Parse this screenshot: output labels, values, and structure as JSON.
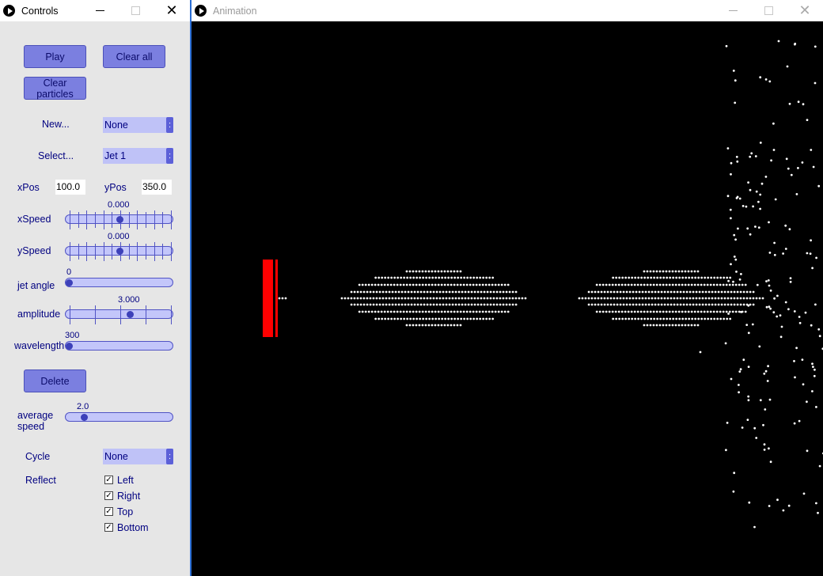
{
  "controls_window": {
    "title": "Controls",
    "minimize_icon": "minimize-icon",
    "maximize_icon": "maximize-icon",
    "close_glyph": "✕"
  },
  "buttons": {
    "play": "Play",
    "clear_all": "Clear all",
    "clear_particles": "Clear particles",
    "delete": "Delete"
  },
  "new_label": "New...",
  "new_selected": "None",
  "select_label": "Select...",
  "select_selected": "Jet 1",
  "dropdown_glyph": ":",
  "xpos": {
    "label": "xPos",
    "value": "100.0"
  },
  "ypos": {
    "label": "yPos",
    "value": "350.0"
  },
  "sliders": {
    "xspeed": {
      "label": "xSpeed",
      "value": "0.000",
      "fraction": 0.5
    },
    "yspeed": {
      "label": "ySpeed",
      "value": "0.000",
      "fraction": 0.5
    },
    "jet_angle": {
      "label": "jet angle",
      "value": "0",
      "fraction": 0.0
    },
    "amplitude": {
      "label": "amplitude",
      "value": "3.000",
      "fraction": 0.6
    },
    "wavelength": {
      "label": "wavelength",
      "value": "300",
      "fraction": 0.0
    },
    "average_speed": {
      "label": "average speed",
      "value": "2.0",
      "fraction": 0.15
    }
  },
  "cycle_label": "Cycle",
  "cycle_selected": "None",
  "reflect": {
    "label": "Reflect",
    "options": [
      {
        "label": "Left",
        "checked": true
      },
      {
        "label": "Right",
        "checked": true
      },
      {
        "label": "Top",
        "checked": true
      },
      {
        "label": "Bottom",
        "checked": true
      }
    ]
  },
  "check_glyph": "✓",
  "animation_window": {
    "title": "Animation",
    "close_glyph": "✕"
  },
  "colors": {
    "button_fill": "#7b7fe0",
    "control_text": "#000080",
    "panel_bg": "#e6e6e6",
    "canvas_bg": "#000000",
    "jet_color": "#ff0000",
    "particle_color": "#ffffff"
  }
}
